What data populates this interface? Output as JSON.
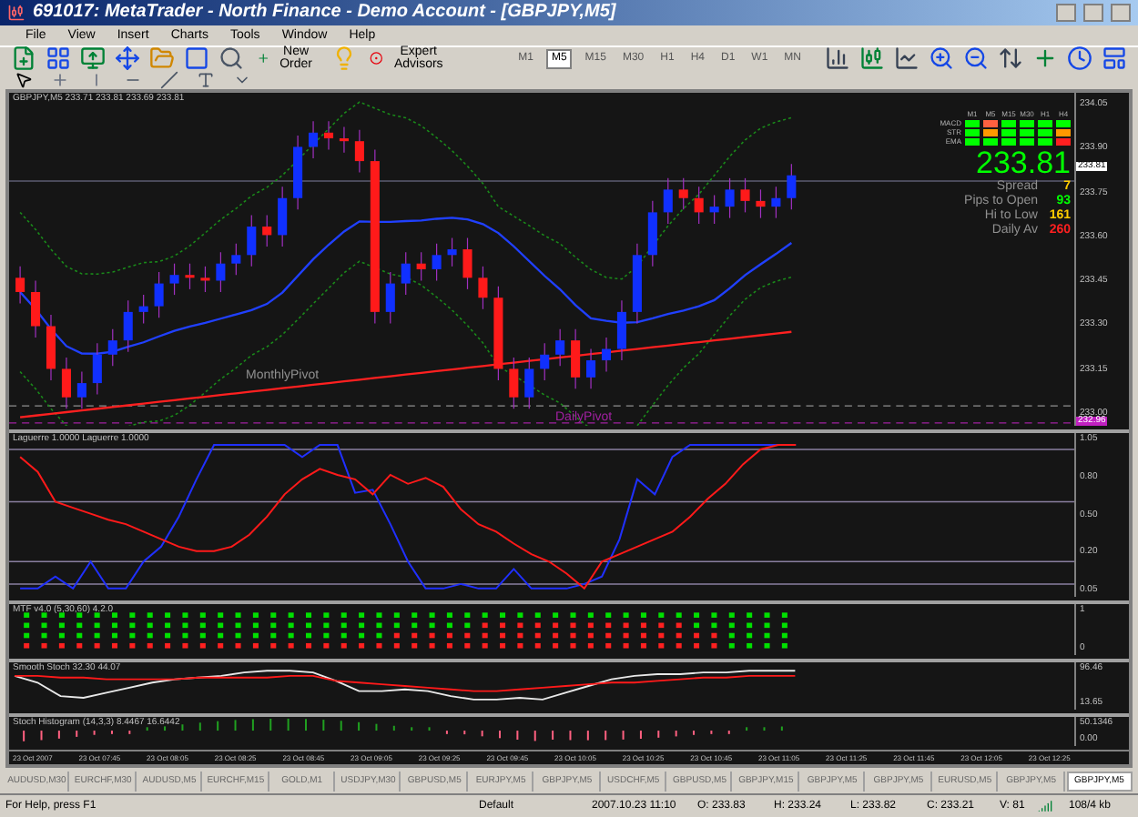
{
  "window": {
    "title": "691017: MetaTrader - North Finance - Demo Account - [GBPJPY,M5]"
  },
  "menu": [
    "File",
    "View",
    "Insert",
    "Charts",
    "Tools",
    "Window",
    "Help"
  ],
  "toolbar": {
    "new_order": "New Order",
    "expert_advisors": "Expert Advisors",
    "timeframes": [
      {
        "label": "M1",
        "selected": false
      },
      {
        "label": "M5",
        "selected": true
      },
      {
        "label": "M15",
        "selected": false
      },
      {
        "label": "M30",
        "selected": false
      },
      {
        "label": "H1",
        "selected": false
      },
      {
        "label": "H4",
        "selected": false
      },
      {
        "label": "D1",
        "selected": false
      },
      {
        "label": "W1",
        "selected": false
      },
      {
        "label": "MN",
        "selected": false
      }
    ]
  },
  "chart": {
    "header": "GBPJPY,M5 233.71 233.81 233.69 233.81",
    "price_axis": [
      "234.05",
      "233.90",
      "233.75",
      "233.60",
      "233.45",
      "233.30",
      "233.15",
      "233.00"
    ],
    "current_price_tag": "233.81",
    "monthly_pivot": "MonthlyPivot",
    "daily_pivot": "DailyPivot",
    "daily_pivot_tag": "232.96",
    "info_panel": {
      "timeframes": [
        "M1",
        "M5",
        "M15",
        "M30",
        "H1",
        "H4"
      ],
      "rows": [
        {
          "label": "MACD",
          "cells": [
            {
              "color": "#00ff00"
            },
            {
              "color": "#ff6040"
            },
            {
              "color": "#00ff00"
            },
            {
              "color": "#00ff00"
            },
            {
              "color": "#00ff00"
            },
            {
              "color": "#00ff00"
            }
          ]
        },
        {
          "label": "STR",
          "cells": [
            {
              "color": "#00ff00"
            },
            {
              "color": "#ff9900"
            },
            {
              "color": "#00ff00"
            },
            {
              "color": "#00ff00"
            },
            {
              "color": "#00ff00"
            },
            {
              "color": "#ff9900"
            }
          ]
        },
        {
          "label": "EMA",
          "cells": [
            {
              "color": "#00ff00"
            },
            {
              "color": "#00ff00"
            },
            {
              "color": "#00ff00"
            },
            {
              "color": "#00ff00"
            },
            {
              "color": "#00ff00"
            },
            {
              "color": "#ff2020"
            }
          ]
        }
      ],
      "price": "233.81",
      "stats": [
        {
          "label": "Spread",
          "value": "7",
          "color": "#ffcc00"
        },
        {
          "label": "Pips to Open",
          "value": "93",
          "color": "#00ff00"
        },
        {
          "label": "Hi to Low",
          "value": "161",
          "color": "#ffcc00"
        },
        {
          "label": "Daily Av",
          "value": "260",
          "color": "#ff2020"
        }
      ]
    },
    "indicators": [
      {
        "kind": "laguerre",
        "label": "Laguerre 1.0000 Laguerre 1.0000",
        "axis": [
          "1.05",
          "0.80",
          "0.50",
          "0.20",
          "0.05"
        ]
      },
      {
        "kind": "dots",
        "label": "MTF v4.0 (5,30,60) 4.2.0",
        "axis": [
          "1",
          "0"
        ]
      },
      {
        "kind": "stoch",
        "label": "Smooth Stoch 32.30 44.07",
        "axis": [
          "96.46",
          "13.65"
        ]
      },
      {
        "kind": "histogram",
        "label": "Stoch Histogram (14,3,3) 8.4467 16.6442",
        "axis": [
          "50.1346",
          "0.00"
        ]
      }
    ],
    "time_axis": [
      "23 Oct 2007",
      "23 Oct 07:45",
      "23 Oct 08:05",
      "23 Oct 08:25",
      "23 Oct 08:45",
      "23 Oct 09:05",
      "23 Oct 09:25",
      "23 Oct 09:45",
      "23 Oct 10:05",
      "23 Oct 10:25",
      "23 Oct 10:45",
      "23 Oct 11:05",
      "23 Oct 11:25",
      "23 Oct 11:45",
      "23 Oct 12:05",
      "23 Oct 12:25"
    ]
  },
  "tabs": [
    {
      "label": "AUDUSD,M30",
      "selected": false
    },
    {
      "label": "EURCHF,M30",
      "selected": false
    },
    {
      "label": "AUDUSD,M5",
      "selected": false
    },
    {
      "label": "EURCHF,M15",
      "selected": false
    },
    {
      "label": "GOLD,M1",
      "selected": false
    },
    {
      "label": "USDJPY,M30",
      "selected": false
    },
    {
      "label": "GBPUSD,M5",
      "selected": false
    },
    {
      "label": "EURJPY,M5",
      "selected": false
    },
    {
      "label": "GBPJPY,M5",
      "selected": false
    },
    {
      "label": "USDCHF,M5",
      "selected": false
    },
    {
      "label": "GBPUSD,M5",
      "selected": false
    },
    {
      "label": "GBPJPY,M15",
      "selected": false
    },
    {
      "label": "GBPJPY,M5",
      "selected": false
    },
    {
      "label": "GBPJPY,M5",
      "selected": false
    },
    {
      "label": "EURUSD,M5",
      "selected": false
    },
    {
      "label": "GBPJPY,M5",
      "selected": false
    },
    {
      "label": "GBPJPY,M5",
      "selected": true
    }
  ],
  "status_bar": {
    "help": "For Help, press F1",
    "profile": "Default",
    "time": "2007.10.23 11:10",
    "open": "O: 233.83",
    "high": "H: 233.24",
    "low": "L: 233.82",
    "close": "C: 233.21",
    "volume": "V: 81",
    "traffic": "108/4 kb"
  }
}
